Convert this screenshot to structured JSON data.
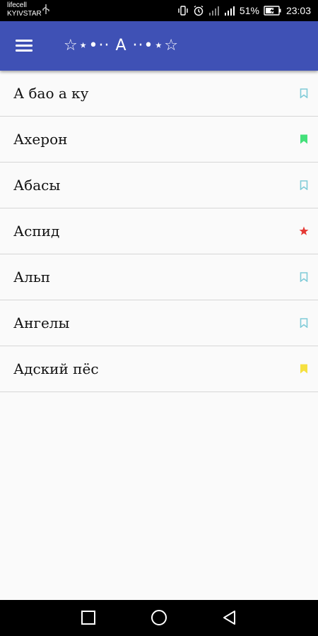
{
  "status_bar": {
    "carrier_line1": "lifecell",
    "carrier_line2": "KYIVSTAR",
    "battery_percent": "51%",
    "time": "23:03"
  },
  "app_bar": {
    "title": "☆⋆•·· A ··•⋆☆",
    "menu_icon": "hamburger-menu-icon",
    "color": "#3f51b5"
  },
  "list": {
    "items": [
      {
        "label": "А бао а ку",
        "icon": "bookmark-outline-icon",
        "color": "#80cbd8"
      },
      {
        "label": "Ахерон",
        "icon": "bookmark-filled-icon",
        "color": "#44e07a"
      },
      {
        "label": "Абасы",
        "icon": "bookmark-outline-icon",
        "color": "#80cbd8"
      },
      {
        "label": "Аспид",
        "icon": "star-icon",
        "color": "#e53935"
      },
      {
        "label": "Альп",
        "icon": "bookmark-outline-icon",
        "color": "#80cbd8"
      },
      {
        "label": "Ангелы",
        "icon": "bookmark-outline-icon",
        "color": "#80cbd8"
      },
      {
        "label": "Адский пёс",
        "icon": "bookmark-filled-icon",
        "color": "#f5e040"
      }
    ]
  },
  "nav_bar": {
    "recents": "square-icon",
    "home": "circle-icon",
    "back": "triangle-back-icon"
  }
}
